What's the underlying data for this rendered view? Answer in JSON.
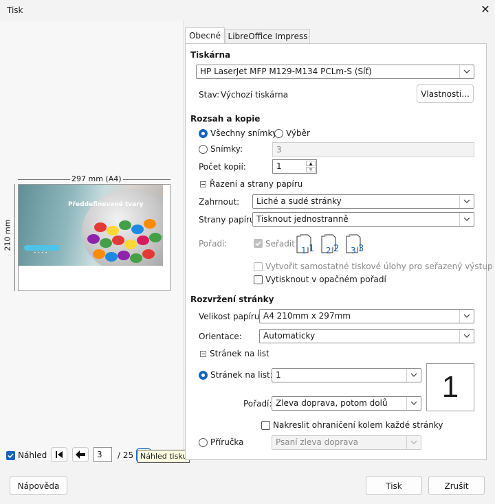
{
  "window": {
    "title": "Tisk"
  },
  "tabs": [
    "Obecné",
    "LibreOffice Impress"
  ],
  "printer": {
    "header": "Tiskárna",
    "selected": "HP LaserJet MFP M129-M134 PCLm-S (Síť)",
    "status_label": "Stav:",
    "status_value": "Výchozí tiskárna",
    "properties_button": "Vlastnosti..."
  },
  "range": {
    "header": "Rozsah a kopie",
    "all_slides": "Všechny snímky",
    "selection": "Výběr",
    "slides": "Snímky:",
    "slides_value": "3",
    "copies_label": "Počet kopií:",
    "copies_value": "1",
    "collate_section": "Řazení a strany papíru",
    "include_label": "Zahrnout:",
    "include_value": "Liché a sudé stránky",
    "sides_label": "Strany papíru:",
    "sides_value": "Tisknout jednostranně",
    "order_label": "Pořadí:",
    "collate": "Seřadit",
    "separate_jobs": "Vytvořit samostatné tiskové úlohy pro seřazený výstup",
    "reverse": "Vytisknout v opačném pořadí"
  },
  "layout": {
    "header": "Rozvržení stránky",
    "paper_size_label": "Velikost papíru:",
    "paper_size_value": "A4 210mm x 297mm",
    "orientation_label": "Orientace:",
    "orientation_value": "Automaticky",
    "pages_per_sheet_section": "Stránek na list",
    "pages_per_sheet_label": "Stránek na list:",
    "pages_per_sheet_value": "1",
    "order_label": "Pořadí:",
    "order_value": "Zleva doprava, potom dolů",
    "preview_number": "1",
    "draw_borders": "Nakreslit ohraničení kolem každé stránky",
    "brochure": "Příručka",
    "brochure_value": "Psaní zleva doprava"
  },
  "preview": {
    "width_label": "297 mm (A4)",
    "height_label": "210 mm",
    "slide_title": "Předdefinované tvary",
    "checkbox": "Náhled",
    "page": "3",
    "total": "/ 25",
    "tooltip": "Náhled tisku"
  },
  "buttons": {
    "help": "Nápověda",
    "print": "Tisk",
    "cancel": "Zrušit"
  },
  "colors": {
    "accent": "#1565c0"
  }
}
